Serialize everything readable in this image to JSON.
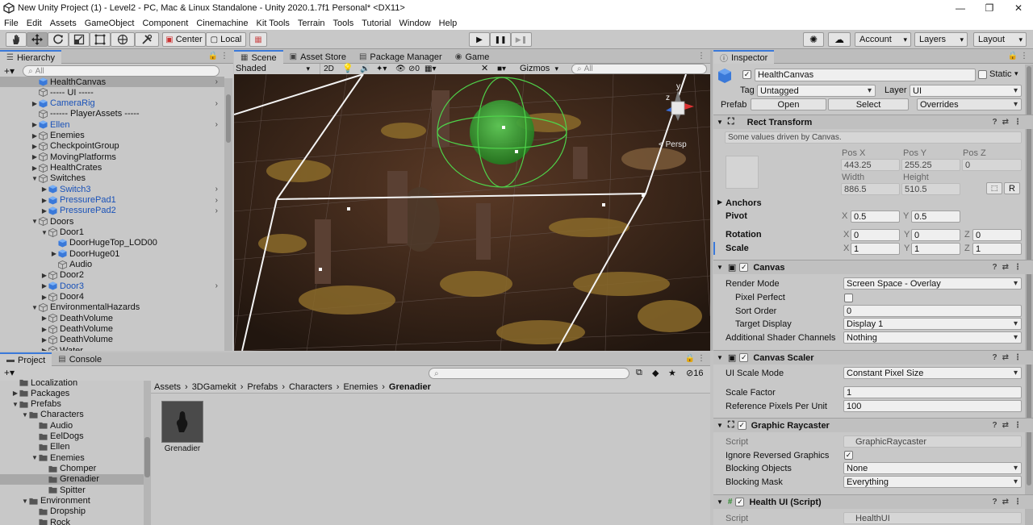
{
  "window": {
    "title": "New Unity Project (1) - Level2 - PC, Mac & Linux Standalone - Unity 2020.1.7f1 Personal* <DX11>",
    "minimize": "—",
    "maximize": "❐",
    "close": "✕"
  },
  "menu": [
    "File",
    "Edit",
    "Assets",
    "GameObject",
    "Component",
    "Cinemachine",
    "Kit Tools",
    "Terrain",
    "Tools",
    "Tutorial",
    "Window",
    "Help"
  ],
  "toolbar": {
    "center_label": "Center",
    "local_label": "Local",
    "account_label": "Account",
    "layers_label": "Layers",
    "layout_label": "Layout"
  },
  "hierarchy": {
    "tab": "Hierarchy",
    "search_placeholder": "All",
    "items": [
      {
        "label": "HealthCanvas",
        "indent": 1,
        "arrow": "",
        "icon": "blue-cube",
        "color": "normal",
        "chevron": true,
        "selected": true
      },
      {
        "label": "----- UI -----",
        "indent": 1,
        "arrow": "",
        "icon": "empty-cube",
        "color": "normal",
        "chevron": false
      },
      {
        "label": "CameraRig",
        "indent": 1,
        "arrow": "▶",
        "icon": "blue-cube",
        "color": "blue",
        "chevron": true
      },
      {
        "label": "------ PlayerAssets -----",
        "indent": 1,
        "arrow": "",
        "icon": "empty-cube",
        "color": "normal",
        "chevron": false
      },
      {
        "label": "Ellen",
        "indent": 1,
        "arrow": "▶",
        "icon": "blue-cube",
        "color": "blue",
        "chevron": true
      },
      {
        "label": "Enemies",
        "indent": 1,
        "arrow": "▶",
        "icon": "empty-cube",
        "color": "normal",
        "chevron": false
      },
      {
        "label": "CheckpointGroup",
        "indent": 1,
        "arrow": "▶",
        "icon": "empty-cube",
        "color": "normal",
        "chevron": false
      },
      {
        "label": "MovingPlatforms",
        "indent": 1,
        "arrow": "▶",
        "icon": "empty-cube",
        "color": "normal",
        "chevron": false
      },
      {
        "label": "HealthCrates",
        "indent": 1,
        "arrow": "▶",
        "icon": "empty-cube",
        "color": "normal",
        "chevron": false
      },
      {
        "label": "Switches",
        "indent": 1,
        "arrow": "▼",
        "icon": "empty-cube",
        "color": "normal",
        "chevron": false
      },
      {
        "label": "Switch3",
        "indent": 2,
        "arrow": "▶",
        "icon": "blue-cube",
        "color": "blue",
        "chevron": true
      },
      {
        "label": "PressurePad1",
        "indent": 2,
        "arrow": "▶",
        "icon": "blue-cube",
        "color": "blue",
        "chevron": true
      },
      {
        "label": "PressurePad2",
        "indent": 2,
        "arrow": "▶",
        "icon": "blue-cube",
        "color": "blue",
        "chevron": true
      },
      {
        "label": "Doors",
        "indent": 1,
        "arrow": "▼",
        "icon": "empty-cube",
        "color": "normal",
        "chevron": false
      },
      {
        "label": "Door1",
        "indent": 2,
        "arrow": "▼",
        "icon": "empty-cube",
        "color": "normal",
        "chevron": false
      },
      {
        "label": "DoorHugeTop_LOD00",
        "indent": 3,
        "arrow": "",
        "icon": "blue-cube",
        "color": "normal",
        "chevron": false
      },
      {
        "label": "DoorHuge01",
        "indent": 3,
        "arrow": "▶",
        "icon": "blue-cube",
        "color": "normal",
        "chevron": false
      },
      {
        "label": "Audio",
        "indent": 3,
        "arrow": "",
        "icon": "empty-cube",
        "color": "normal",
        "chevron": false
      },
      {
        "label": "Door2",
        "indent": 2,
        "arrow": "▶",
        "icon": "empty-cube",
        "color": "normal",
        "chevron": false
      },
      {
        "label": "Door3",
        "indent": 2,
        "arrow": "▶",
        "icon": "blue-cube",
        "color": "blue",
        "chevron": true
      },
      {
        "label": "Door4",
        "indent": 2,
        "arrow": "▶",
        "icon": "empty-cube",
        "color": "normal",
        "chevron": false
      },
      {
        "label": "EnvironmentalHazards",
        "indent": 1,
        "arrow": "▼",
        "icon": "empty-cube",
        "color": "normal",
        "chevron": false
      },
      {
        "label": "DeathVolume",
        "indent": 2,
        "arrow": "▶",
        "icon": "empty-cube",
        "color": "normal",
        "chevron": false
      },
      {
        "label": "DeathVolume",
        "indent": 2,
        "arrow": "▶",
        "icon": "empty-cube",
        "color": "normal",
        "chevron": false
      },
      {
        "label": "DeathVolume",
        "indent": 2,
        "arrow": "▶",
        "icon": "empty-cube",
        "color": "normal",
        "chevron": false
      },
      {
        "label": "Water",
        "indent": 2,
        "arrow": "▶",
        "icon": "empty-cube",
        "color": "normal",
        "chevron": false
      }
    ]
  },
  "scene": {
    "tabs": [
      "Scene",
      "Asset Store",
      "Package Manager",
      "Game"
    ],
    "shading": "Shaded",
    "mode_2d": "2D",
    "hidden_count": "0",
    "gizmos": "Gizmos",
    "search_placeholder": "All",
    "persp_label": "< Persp",
    "axis_y": "y",
    "axis_z": "z"
  },
  "project": {
    "tabs": [
      "Project",
      "Console"
    ],
    "count": "16",
    "breadcrumb": [
      "Assets",
      "3DGamekit",
      "Prefabs",
      "Characters",
      "Enemies",
      "Grenadier"
    ],
    "asset_label": "Grenadier",
    "folders": [
      {
        "label": "Localization",
        "indent": 1,
        "arrow": ""
      },
      {
        "label": "Packages",
        "indent": 1,
        "arrow": "▶"
      },
      {
        "label": "Prefabs",
        "indent": 1,
        "arrow": "▼"
      },
      {
        "label": "Characters",
        "indent": 2,
        "arrow": "▼"
      },
      {
        "label": "Audio",
        "indent": 3,
        "arrow": ""
      },
      {
        "label": "EelDogs",
        "indent": 3,
        "arrow": ""
      },
      {
        "label": "Ellen",
        "indent": 3,
        "arrow": ""
      },
      {
        "label": "Enemies",
        "indent": 3,
        "arrow": "▼"
      },
      {
        "label": "Chomper",
        "indent": 4,
        "arrow": ""
      },
      {
        "label": "Grenadier",
        "indent": 4,
        "arrow": "",
        "selected": true
      },
      {
        "label": "Spitter",
        "indent": 4,
        "arrow": ""
      },
      {
        "label": "Environment",
        "indent": 2,
        "arrow": "▼"
      },
      {
        "label": "Dropship",
        "indent": 3,
        "arrow": ""
      },
      {
        "label": "Rock",
        "indent": 3,
        "arrow": ""
      }
    ]
  },
  "inspector": {
    "tab": "Inspector",
    "object_name": "HealthCanvas",
    "static_label": "Static",
    "tag_label": "Tag",
    "tag_value": "Untagged",
    "layer_label": "Layer",
    "layer_value": "UI",
    "prefab_label": "Prefab",
    "open_label": "Open",
    "select_label": "Select",
    "overrides_label": "Overrides",
    "rect_transform": {
      "title": "Rect Transform",
      "note": "Some values driven by Canvas.",
      "posx_label": "Pos X",
      "posy_label": "Pos Y",
      "posz_label": "Pos Z",
      "posx": "443.25",
      "posy": "255.25",
      "posz": "0",
      "width_label": "Width",
      "height_label": "Height",
      "width": "886.5",
      "height": "510.5",
      "r_label": "R",
      "anchors_label": "Anchors",
      "pivot_label": "Pivot",
      "pivot_x": "0.5",
      "pivot_y": "0.5",
      "rotation_label": "Rotation",
      "rot_x": "0",
      "rot_y": "0",
      "rot_z": "0",
      "scale_label": "Scale",
      "scale_x": "1",
      "scale_y": "1",
      "scale_z": "1",
      "x": "X",
      "y": "Y",
      "z": "Z"
    },
    "canvas": {
      "title": "Canvas",
      "render_mode_label": "Render Mode",
      "render_mode": "Screen Space - Overlay",
      "pixel_perfect_label": "Pixel Perfect",
      "sort_order_label": "Sort Order",
      "sort_order": "0",
      "target_display_label": "Target Display",
      "target_display": "Display 1",
      "shader_channels_label": "Additional Shader Channels",
      "shader_channels": "Nothing"
    },
    "canvas_scaler": {
      "title": "Canvas Scaler",
      "ui_scale_mode_label": "UI Scale Mode",
      "ui_scale_mode": "Constant Pixel Size",
      "scale_factor_label": "Scale Factor",
      "scale_factor": "1",
      "ref_ppu_label": "Reference Pixels Per Unit",
      "ref_ppu": "100"
    },
    "graphic_raycaster": {
      "title": "Graphic Raycaster",
      "script_label": "Script",
      "script_value": "GraphicRaycaster",
      "ignore_reversed_label": "Ignore Reversed Graphics",
      "blocking_objects_label": "Blocking Objects",
      "blocking_objects": "None",
      "blocking_mask_label": "Blocking Mask",
      "blocking_mask": "Everything"
    },
    "health_ui": {
      "title": "Health UI (Script)",
      "script_label": "Script",
      "script_value": "HealthUI"
    }
  },
  "colors": {
    "accent": "#3a79d9",
    "blue_text": "#1a52b8",
    "panel_bg": "#c8c8c8",
    "scene_bg": "#3a2a22"
  }
}
